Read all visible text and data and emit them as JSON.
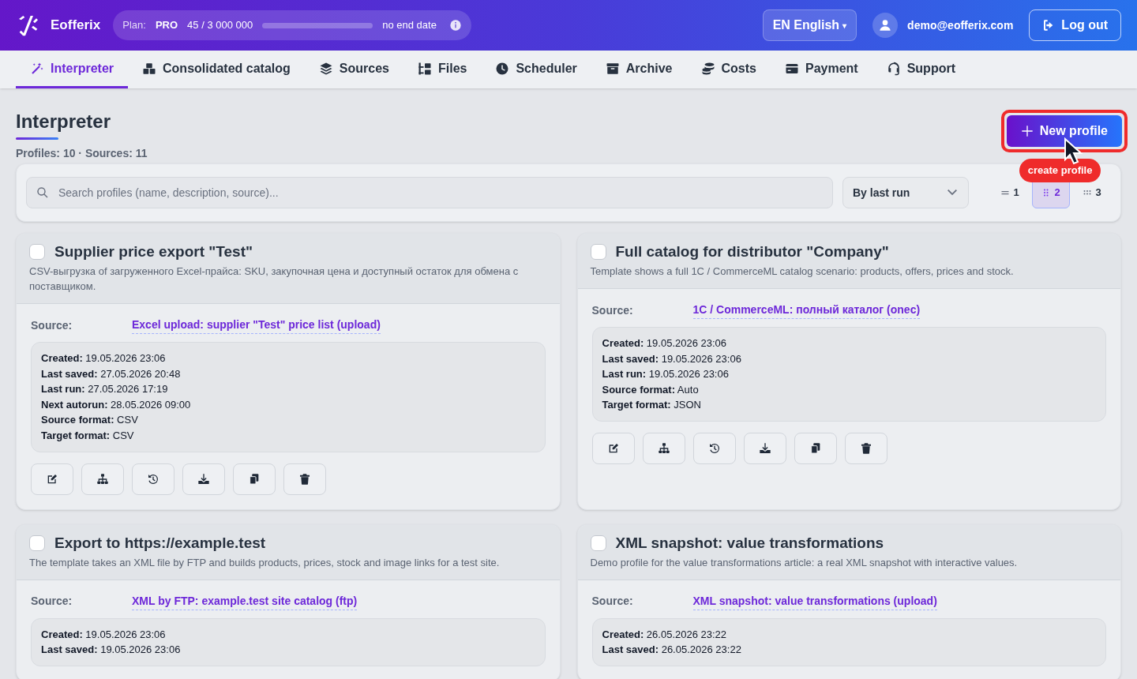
{
  "brand": {
    "name": "Eofferix"
  },
  "plan": {
    "label": "Plan:",
    "name": "PRO",
    "usage": "45 / 3 000 000",
    "level": 0,
    "end": "no end date"
  },
  "language": {
    "label": "EN English",
    "caret": "▾"
  },
  "user": {
    "email": "demo@eofferix.com"
  },
  "logout": {
    "label": "Log out"
  },
  "nav": [
    {
      "kind": "wand",
      "label": "Interpreter",
      "selected": true
    },
    {
      "kind": "boxes",
      "label": "Consolidated catalog",
      "selected": false
    },
    {
      "kind": "layers",
      "label": "Sources",
      "selected": false
    },
    {
      "kind": "tree",
      "label": "Files",
      "selected": false
    },
    {
      "kind": "clock",
      "label": "Scheduler",
      "selected": false
    },
    {
      "kind": "archive",
      "label": "Archive",
      "selected": false
    },
    {
      "kind": "coins",
      "label": "Costs",
      "selected": false
    },
    {
      "kind": "card",
      "label": "Payment",
      "selected": false
    },
    {
      "kind": "headset",
      "label": "Support",
      "selected": false
    }
  ],
  "page": {
    "title": "Interpreter",
    "summary": "Profiles: 10 · Sources: 11"
  },
  "new_profile": {
    "label": "New profile",
    "tooltip": "create profile"
  },
  "search": {
    "placeholder": "Search profiles (name, description, source)..."
  },
  "sort": {
    "value": "By last run"
  },
  "views": [
    {
      "kind": "list",
      "label": "1",
      "selected": false
    },
    {
      "kind": "grid2",
      "label": "2",
      "selected": true
    },
    {
      "kind": "grid3",
      "label": "3",
      "selected": false
    }
  ],
  "profiles": [
    {
      "checked": false,
      "title": "Supplier price export \"Test\"",
      "description": "CSV-выгрузка of загруженного Excel-прайса: SKU, закупочная цена и доступный остаток для обмена с поставщиком.",
      "source_label": "Source:",
      "source": "Excel upload: supplier \"Test\" price list (upload)",
      "details": [
        {
          "label": "Created:",
          "value": "19.05.2026 23:06"
        },
        {
          "label": "Last saved:",
          "value": "27.05.2026 20:48"
        },
        {
          "label": "Last run:",
          "value": "27.05.2026 17:19"
        },
        {
          "label": "Next autorun:",
          "value": "28.05.2026 09:00"
        },
        {
          "label": "Source format:",
          "value": "CSV"
        },
        {
          "label": "Target format:",
          "value": "CSV"
        }
      ],
      "actions": [
        {
          "kind": "edit"
        },
        {
          "kind": "structure"
        },
        {
          "kind": "history"
        },
        {
          "kind": "download"
        },
        {
          "kind": "copy"
        },
        {
          "kind": "delete"
        }
      ]
    },
    {
      "checked": false,
      "title": "Full catalog for distributor \"Company\"",
      "description": "Template shows a full 1C / CommerceML catalog scenario: products, offers, prices and stock.",
      "source_label": "Source:",
      "source": "1C / CommerceML: полный каталог (onec)",
      "details": [
        {
          "label": "Created:",
          "value": "19.05.2026 23:06"
        },
        {
          "label": "Last saved:",
          "value": "19.05.2026 23:06"
        },
        {
          "label": "Last run:",
          "value": "19.05.2026 23:06"
        },
        {
          "label": "Source format:",
          "value": "Auto"
        },
        {
          "label": "Target format:",
          "value": "JSON"
        }
      ],
      "actions": [
        {
          "kind": "edit"
        },
        {
          "kind": "structure"
        },
        {
          "kind": "history"
        },
        {
          "kind": "download"
        },
        {
          "kind": "copy"
        },
        {
          "kind": "delete"
        }
      ]
    },
    {
      "checked": false,
      "title": "Export to https://example.test",
      "description": "The template takes an XML file by FTP and builds products, prices, stock and image links for a test site.",
      "source_label": "Source:",
      "source": "XML by FTP: example.test site catalog (ftp)",
      "details": [
        {
          "label": "Created:",
          "value": "19.05.2026 23:06"
        },
        {
          "label": "Last saved:",
          "value": "19.05.2026 23:06"
        }
      ]
    },
    {
      "checked": false,
      "title": "XML snapshot: value transformations",
      "description": "Demo profile for the value transformations article: a real XML snapshot with interactive values.",
      "source_label": "Source:",
      "source": "XML snapshot: value transformations (upload)",
      "details": [
        {
          "label": "Created:",
          "value": "26.05.2026 23:22"
        },
        {
          "label": "Last saved:",
          "value": "26.05.2026 23:22"
        }
      ]
    }
  ]
}
